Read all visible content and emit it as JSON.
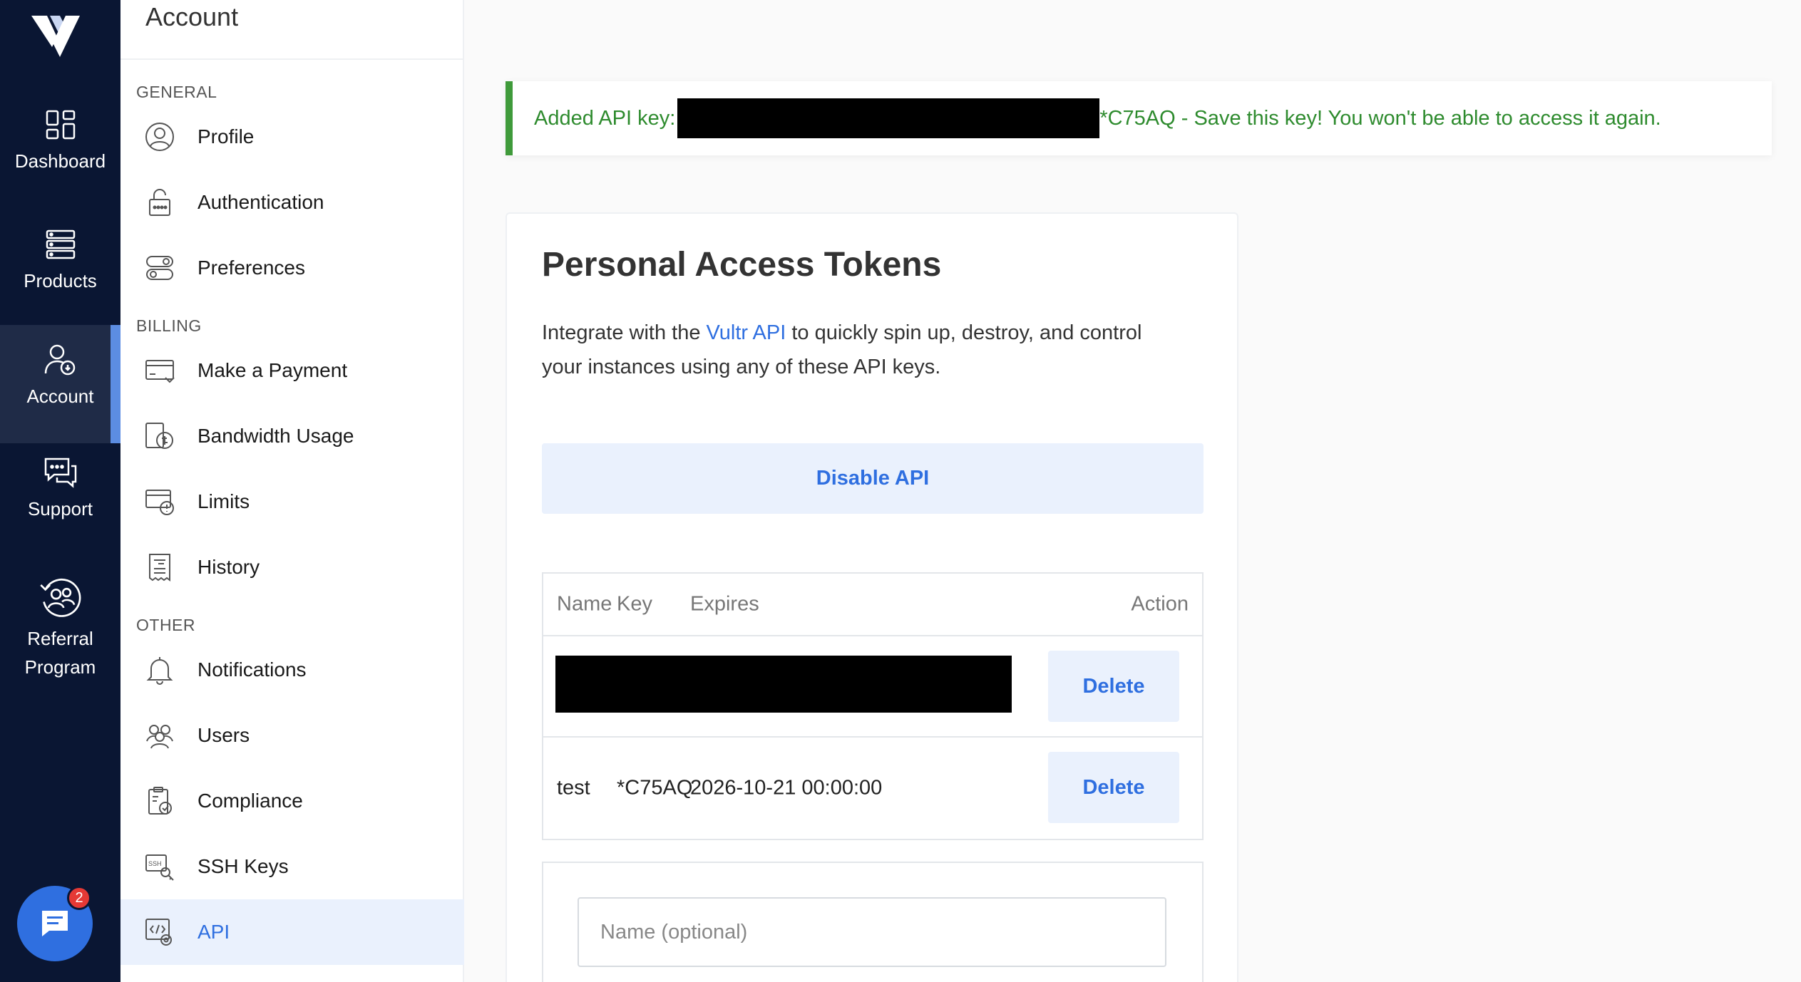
{
  "rail": {
    "items": [
      {
        "label": "Dashboard",
        "icon": "dashboard-icon"
      },
      {
        "label": "Products",
        "icon": "products-icon"
      },
      {
        "label": "Account",
        "icon": "account-icon"
      },
      {
        "label": "Support",
        "icon": "support-icon"
      },
      {
        "label": "Referral Program",
        "icon": "referral-icon"
      }
    ],
    "chat_badge": "2"
  },
  "subnav": {
    "title": "Account",
    "sections": {
      "general": "GENERAL",
      "billing": "BILLING",
      "other": "OTHER"
    },
    "items": [
      {
        "label": "Profile",
        "icon": "profile-icon"
      },
      {
        "label": "Authentication",
        "icon": "lock-icon"
      },
      {
        "label": "Preferences",
        "icon": "toggles-icon"
      },
      {
        "label": "Make a Payment",
        "icon": "card-icon"
      },
      {
        "label": "Bandwidth Usage",
        "icon": "bandwidth-icon"
      },
      {
        "label": "Limits",
        "icon": "limits-icon"
      },
      {
        "label": "History",
        "icon": "receipt-icon"
      },
      {
        "label": "Notifications",
        "icon": "bell-icon"
      },
      {
        "label": "Users",
        "icon": "users-icon"
      },
      {
        "label": "Compliance",
        "icon": "clipboard-icon"
      },
      {
        "label": "SSH Keys",
        "icon": "ssh-key-icon"
      },
      {
        "label": "API",
        "icon": "api-icon"
      }
    ]
  },
  "alert": {
    "prefix": "Added API key:",
    "suffix": "*C75AQ - Save this key! You won't be able to access it again."
  },
  "card": {
    "title": "Personal Access Tokens",
    "desc_before": "Integrate with the ",
    "desc_link": "Vultr API",
    "desc_after": " to quickly spin up, destroy, and control your instances using any of these API keys.",
    "disable_label": "Disable API"
  },
  "tokens": {
    "headers": {
      "name": "Name",
      "key": "Key",
      "expires": "Expires",
      "action": "Action"
    },
    "rows": [
      {
        "name": "",
        "key": "",
        "expires": "",
        "action": "Delete"
      },
      {
        "name": "test",
        "key": "*C75AQ",
        "expires": "2026-10-21 00:00:00",
        "action": "Delete"
      }
    ]
  },
  "add": {
    "name_placeholder": "Name (optional)",
    "name_value": ""
  },
  "colors": {
    "rail_bg": "#0a1633",
    "accent": "#2f6fe0",
    "success": "#3f9a3a"
  }
}
